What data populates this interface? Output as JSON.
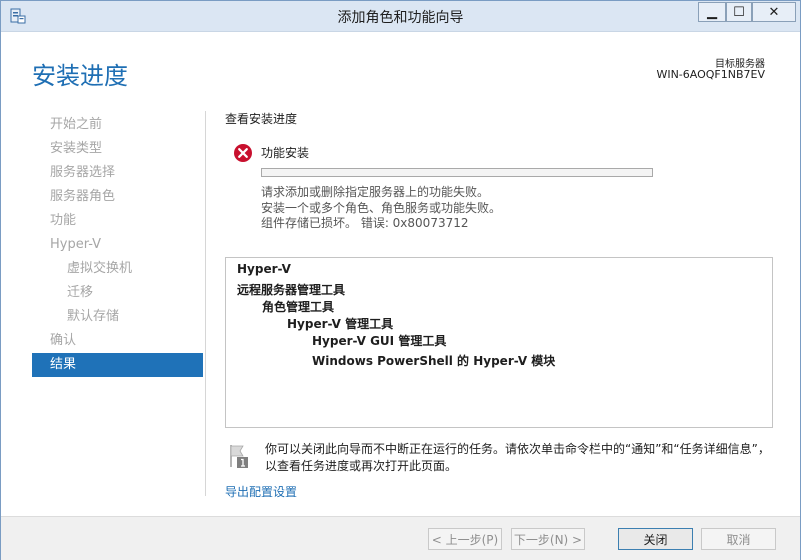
{
  "window": {
    "title": "添加角色和功能向导",
    "controls": {
      "minimize": "▁",
      "maximize": "☐",
      "close": "✕"
    }
  },
  "header": {
    "page_title": "安装进度",
    "target_label": "目标服务器",
    "target_server": "WIN-6AOQF1NB7EV"
  },
  "nav": {
    "items": [
      {
        "label": "开始之前",
        "state": "disabled",
        "level": 0
      },
      {
        "label": "安装类型",
        "state": "disabled",
        "level": 0
      },
      {
        "label": "服务器选择",
        "state": "disabled",
        "level": 0
      },
      {
        "label": "服务器角色",
        "state": "disabled",
        "level": 0
      },
      {
        "label": "功能",
        "state": "disabled",
        "level": 0
      },
      {
        "label": "Hyper-V",
        "state": "disabled",
        "level": 0
      },
      {
        "label": "虚拟交换机",
        "state": "disabled",
        "level": 1
      },
      {
        "label": "迁移",
        "state": "disabled",
        "level": 1
      },
      {
        "label": "默认存储",
        "state": "disabled",
        "level": 1
      },
      {
        "label": "确认",
        "state": "disabled",
        "level": 0
      },
      {
        "label": "结果",
        "state": "active",
        "level": 0
      }
    ]
  },
  "content": {
    "section_heading": "查看安装进度",
    "feature_title": "功能安装",
    "progress_fraction": 0,
    "messages": [
      "请求添加或删除指定服务器上的功能失败。",
      "安装一个或多个角色、角色服务或功能失败。",
      "组件存储已损坏。 错误: 0x80073712"
    ],
    "results": [
      {
        "text": "Hyper-V",
        "indent": 0
      },
      {
        "text": "远程服务器管理工具",
        "indent": 0
      },
      {
        "text": "角色管理工具",
        "indent": 1
      },
      {
        "text": "Hyper-V 管理工具",
        "indent": 2
      },
      {
        "text": "Hyper-V GUI 管理工具",
        "indent": 3
      },
      {
        "text": "Windows PowerShell 的 Hyper-V 模块",
        "indent": 3
      }
    ],
    "info_text": "你可以关闭此向导而不中断正在运行的任务。请依次单击命令栏中的“通知”和“任务详细信息”，以查看任务进度或再次打开此页面。",
    "export_link": "导出配置设置"
  },
  "footer": {
    "prev_label": "< 上一步(P)",
    "next_label": "下一步(N) >",
    "close_label": "关闭",
    "cancel_label": "取消"
  },
  "colors": {
    "accent": "#1f72b8",
    "title_blue": "#1f6fb4",
    "error_red": "#c8102e",
    "disabled_text": "#a6a6a6"
  }
}
